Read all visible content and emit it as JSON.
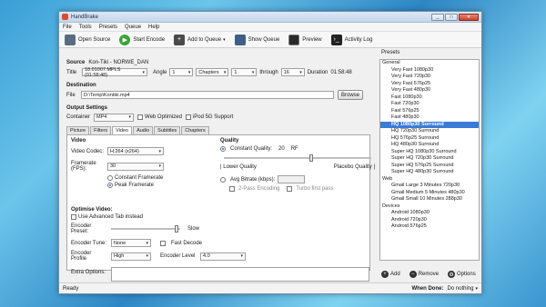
{
  "window": {
    "title": "HandBrake",
    "min": "_",
    "max": "□",
    "close": "✕"
  },
  "menu": [
    "File",
    "Tools",
    "Presets",
    "Queue",
    "Help"
  ],
  "toolbar": {
    "open_source": "Open Source",
    "start_encode": "Start Encode",
    "add_to_queue": "Add to Queue",
    "show_queue": "Show Queue",
    "preview": "Preview",
    "activity_log": "Activity Log"
  },
  "source": {
    "label": "Source",
    "name": "Kon-Tiki - NORWE_DAN",
    "title_label": "Title",
    "title_value": "18.01007.MPLS (01:58:48)",
    "angle_label": "Angle",
    "angle_value": "1",
    "range_type": "Chapters",
    "range_from": "1",
    "through_label": "through",
    "range_to": "16",
    "duration_label": "Duration",
    "duration_value": "01:58:48"
  },
  "destination": {
    "label": "Destination",
    "file_label": "File",
    "file_value": "D:\\Temp\\Kontiki.mp4",
    "browse": "Browse"
  },
  "output": {
    "label": "Output Settings",
    "container_label": "Container",
    "container_value": "MP4",
    "web_optimized": "Web Optimized",
    "ipod": "iPod 5G Support"
  },
  "tabs": [
    "Picture",
    "Filters",
    "Video",
    "Audio",
    "Subtitles",
    "Chapters"
  ],
  "video": {
    "heading": "Video",
    "codec_label": "Video Codec:",
    "codec_value": "H.264 (x264)",
    "framerate_label": "Framerate (FPS):",
    "framerate_value": "30",
    "constant_fr": "Constant Framerate",
    "peak_fr": "Peak Framerate",
    "quality_heading": "Quality",
    "constant_quality_label": "Constant Quality:",
    "constant_quality_value": "20",
    "rf": "RF",
    "lower_quality": "| Lower Quality",
    "placebo_quality": "Placebo Quality |",
    "avg_bitrate": "Avg Bitrate (kbps):",
    "two_pass": "2-Pass Encoding",
    "turbo": "Turbo first pass",
    "optimise_heading": "Optimise Video:",
    "adv_tab": "Use Advanced Tab instead",
    "preset_label": "Encoder Preset:",
    "preset_slow": "Slow",
    "tune_label": "Encoder Tune:",
    "tune_value": "None",
    "fast_decode": "Fast Decode",
    "profile_label": "Encoder Profile",
    "profile_value": "High",
    "level_label": "Encoder Level",
    "level_value": "4.0",
    "extra_label": "Extra Options:"
  },
  "presets": {
    "heading": "Presets",
    "groups": [
      {
        "name": "General",
        "items": [
          "Very Fast 1080p30",
          "Very Fast 720p30",
          "Very Fast 576p25",
          "Very Fast 480p30",
          "Fast 1080p30",
          "Fast 720p30",
          "Fast 576p25",
          "Fast 480p30",
          "HQ 1080p30 Surround",
          "HQ 720p30 Surround",
          "HQ 576p25 Surround",
          "HQ 480p30 Surround",
          "Super HQ 1080p30 Surround",
          "Super HQ 720p30 Surround",
          "Super HQ 576p25 Surround",
          "Super HQ 480p30 Surround"
        ]
      },
      {
        "name": "Web",
        "items": [
          "Gmail Large 3 Minutes 720p30",
          "Gmail Medium 5 Minutes 480p30",
          "Gmail Small 10 Minutes 288p30"
        ]
      },
      {
        "name": "Devices",
        "items": [
          "Android 1080p30",
          "Android 720p30",
          "Android 576p25"
        ]
      }
    ],
    "selected": "HQ 1080p30 Surround",
    "add": "Add",
    "remove": "Remove",
    "options": "Options"
  },
  "status": {
    "ready": "Ready",
    "when_done_label": "When Done:",
    "when_done_value": "Do nothing"
  }
}
